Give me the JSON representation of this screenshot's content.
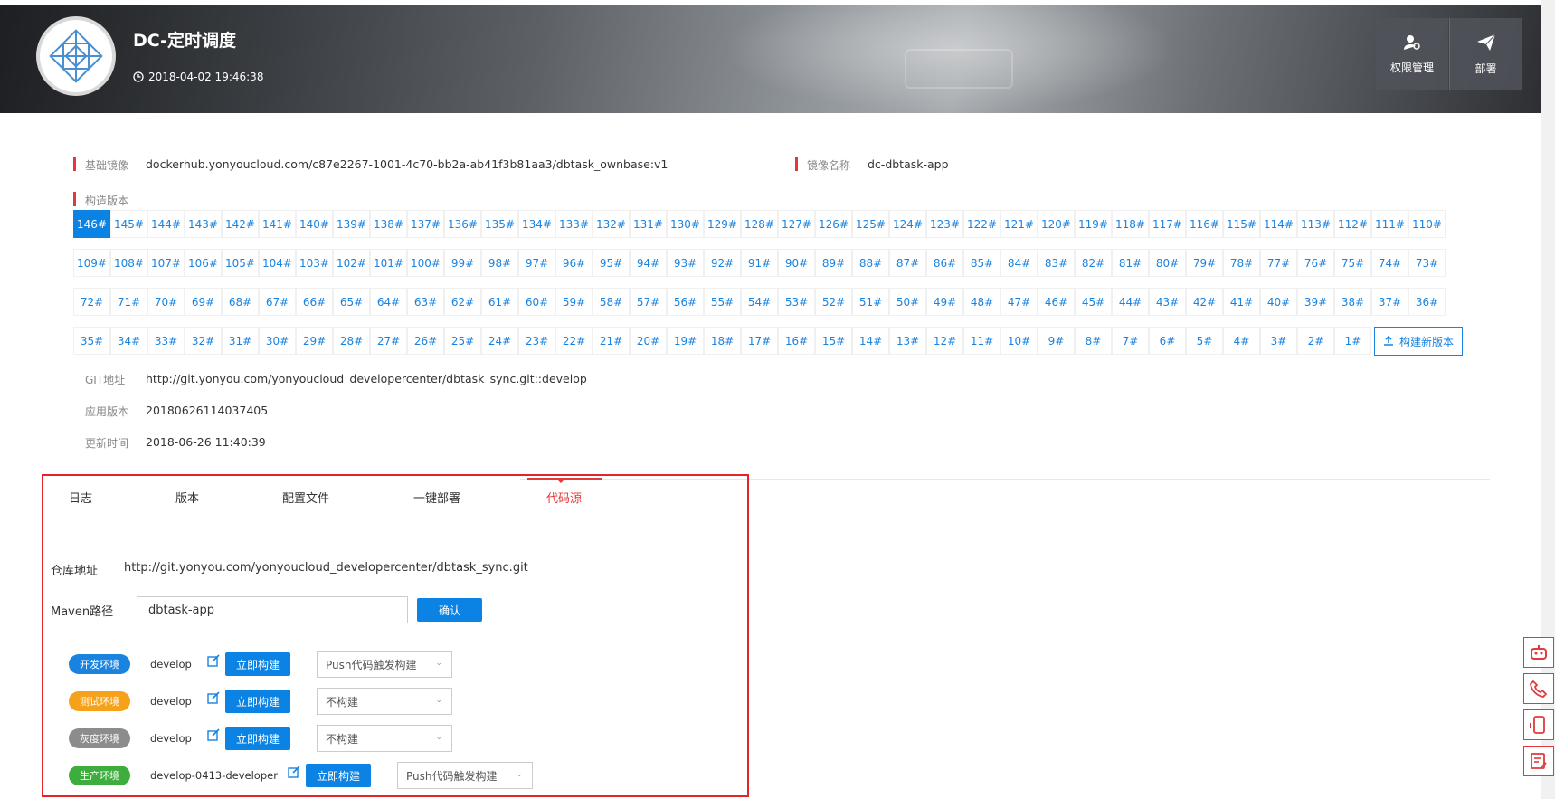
{
  "header": {
    "title": "DC-定时调度",
    "timestamp": "2018-04-02 19:46:38",
    "buttons": [
      {
        "label": "权限管理",
        "icon": "user-gear-icon"
      },
      {
        "label": "部署",
        "icon": "paper-plane-icon"
      }
    ]
  },
  "info": {
    "base_image_label": "基础镜像",
    "base_image_value": "dockerhub.yonyoucloud.com/c87e2267-1001-4c70-bb2a-ab41f3b81aa3/dbtask_ownbase:v1",
    "image_name_label": "镜像名称",
    "image_name_value": "dc-dbtask-app",
    "build_version_label": "构造版本",
    "versions": [
      "146#",
      "145#",
      "144#",
      "143#",
      "142#",
      "141#",
      "140#",
      "139#",
      "138#",
      "137#",
      "136#",
      "135#",
      "134#",
      "133#",
      "132#",
      "131#",
      "130#",
      "129#",
      "128#",
      "127#",
      "126#",
      "125#",
      "124#",
      "123#",
      "122#",
      "121#",
      "120#",
      "119#",
      "118#",
      "117#",
      "116#",
      "115#",
      "114#",
      "113#",
      "112#",
      "111#",
      "110#",
      "109#",
      "108#",
      "107#",
      "106#",
      "105#",
      "104#",
      "103#",
      "102#",
      "101#",
      "100#",
      "99#",
      "98#",
      "97#",
      "96#",
      "95#",
      "94#",
      "93#",
      "92#",
      "91#",
      "90#",
      "89#",
      "88#",
      "87#",
      "86#",
      "85#",
      "84#",
      "83#",
      "82#",
      "81#",
      "80#",
      "79#",
      "78#",
      "77#",
      "76#",
      "75#",
      "74#",
      "73#",
      "72#",
      "71#",
      "70#",
      "69#",
      "68#",
      "67#",
      "66#",
      "65#",
      "64#",
      "63#",
      "62#",
      "61#",
      "60#",
      "59#",
      "58#",
      "57#",
      "56#",
      "55#",
      "54#",
      "53#",
      "52#",
      "51#",
      "50#",
      "49#",
      "48#",
      "47#",
      "46#",
      "45#",
      "44#",
      "43#",
      "42#",
      "41#",
      "40#",
      "39#",
      "38#",
      "37#",
      "36#",
      "35#",
      "34#",
      "33#",
      "32#",
      "31#",
      "30#",
      "29#",
      "28#",
      "27#",
      "26#",
      "25#",
      "24#",
      "23#",
      "22#",
      "21#",
      "20#",
      "19#",
      "18#",
      "17#",
      "16#",
      "15#",
      "14#",
      "13#",
      "12#",
      "11#",
      "10#",
      "9#",
      "8#",
      "7#",
      "6#",
      "5#",
      "4#",
      "3#",
      "2#",
      "1#"
    ],
    "active_version": "146#",
    "build_new_label": "构建新版本",
    "git_label": "GIT地址",
    "git_value": "http://git.yonyou.com/yonyoucloud_developercenter/dbtask_sync.git::develop",
    "app_version_label": "应用版本",
    "app_version_value": "20180626114037405",
    "update_time_label": "更新时间",
    "update_time_value": "2018-06-26 11:40:39"
  },
  "tabs": [
    {
      "label": "日志"
    },
    {
      "label": "版本"
    },
    {
      "label": "配置文件"
    },
    {
      "label": "一键部署"
    },
    {
      "label": "代码源",
      "active": true
    }
  ],
  "code_source": {
    "repo_label": "仓库地址",
    "repo_value": "http://git.yonyou.com/yonyoucloud_developercenter/dbtask_sync.git",
    "maven_label": "Maven路径",
    "maven_value": "dbtask-app",
    "confirm_label": "确认",
    "envs": [
      {
        "env": "开发环境",
        "color": "#1a83e0",
        "branch": "develop",
        "build_label": "立即构建",
        "trigger": "Push代码触发构建"
      },
      {
        "env": "测试环境",
        "color": "#f5a11a",
        "branch": "develop",
        "build_label": "立即构建",
        "trigger": "不构建"
      },
      {
        "env": "灰度环境",
        "color": "#8c8c8c",
        "branch": "develop",
        "build_label": "立即构建",
        "trigger": "不构建"
      },
      {
        "env": "生产环境",
        "color": "#3dae3d",
        "branch": "develop-0413-developer",
        "build_label": "立即构建",
        "trigger": "Push代码触发构建"
      }
    ]
  },
  "side_tools": [
    "robot-icon",
    "phone-icon",
    "mobile-icon",
    "feedback-icon"
  ],
  "colors": {
    "accent": "#0a83e5",
    "highlight": "#e4393c"
  }
}
